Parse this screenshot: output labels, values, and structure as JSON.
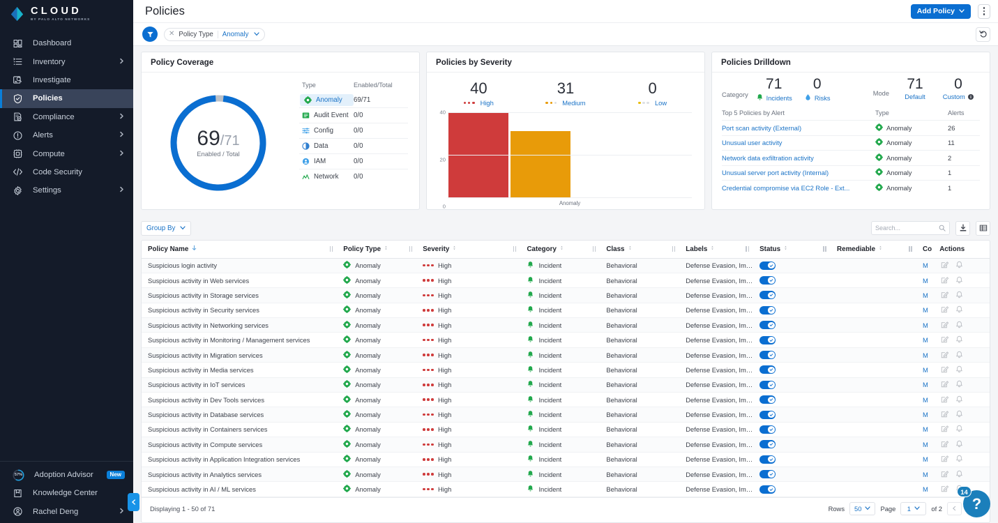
{
  "sidebar": {
    "logo": {
      "title": "CLOUD",
      "subtitle": "BY PALO ALTO NETWORKS"
    },
    "items": [
      {
        "label": "Dashboard",
        "icon": "dashboard-icon",
        "expandable": false,
        "active": false
      },
      {
        "label": "Inventory",
        "icon": "inventory-icon",
        "expandable": true,
        "active": false
      },
      {
        "label": "Investigate",
        "icon": "investigate-icon",
        "expandable": false,
        "active": false
      },
      {
        "label": "Policies",
        "icon": "shield-icon",
        "expandable": false,
        "active": true
      },
      {
        "label": "Compliance",
        "icon": "compliance-icon",
        "expandable": true,
        "active": false
      },
      {
        "label": "Alerts",
        "icon": "alert-icon",
        "expandable": true,
        "active": false
      },
      {
        "label": "Compute",
        "icon": "compute-icon",
        "expandable": true,
        "active": false
      },
      {
        "label": "Code Security",
        "icon": "code-icon",
        "expandable": false,
        "active": false
      },
      {
        "label": "Settings",
        "icon": "gear-icon",
        "expandable": true,
        "active": false
      }
    ],
    "bottom": [
      {
        "label": "Adoption Advisor",
        "icon": "progress-ring-icon",
        "progress": "57%",
        "badge": "New",
        "expandable": false
      },
      {
        "label": "Knowledge Center",
        "icon": "book-icon",
        "expandable": false
      },
      {
        "label": "Rachel Deng",
        "icon": "user-icon",
        "expandable": true
      }
    ]
  },
  "header": {
    "title": "Policies",
    "add_policy_label": "Add Policy",
    "kebab_name": "more-options"
  },
  "filter_bar": {
    "funnel_name": "filter-icon",
    "chip": {
      "key": "Policy Type",
      "value": "Anomaly"
    },
    "reset_name": "reset-filters-icon"
  },
  "policy_coverage": {
    "title": "Policy Coverage",
    "enabled": "69",
    "total": "/71",
    "center_label": "Enabled / Total",
    "columns": {
      "type": "Type",
      "enabled_total": "Enabled/Total"
    },
    "rows": [
      {
        "type": "Anomaly",
        "value": "69/71",
        "selected": true,
        "color": "#21a84c"
      },
      {
        "type": "Audit Event",
        "value": "0/0",
        "selected": false,
        "color": "#21a84c"
      },
      {
        "type": "Config",
        "value": "0/0",
        "selected": false,
        "color": "#3fa0e8"
      },
      {
        "type": "Data",
        "value": "0/0",
        "selected": false,
        "color": "#2f7fd0"
      },
      {
        "type": "IAM",
        "value": "0/0",
        "selected": false,
        "color": "#3fa0e8"
      },
      {
        "type": "Network",
        "value": "0/0",
        "selected": false,
        "color": "#21a84c"
      }
    ]
  },
  "policies_by_severity": {
    "title": "Policies by Severity",
    "stats": [
      {
        "value": "40",
        "label": "High",
        "dots": 3,
        "color": "#cf3b3b"
      },
      {
        "value": "31",
        "label": "Medium",
        "dots": 2,
        "color": "#e89b09"
      },
      {
        "value": "0",
        "label": "Low",
        "dots": 1,
        "color": "#e8bc09"
      }
    ]
  },
  "chart_data": {
    "type": "bar",
    "title": "Policies by Severity",
    "categories": [
      "Anomaly"
    ],
    "series": [
      {
        "name": "High",
        "values": [
          40
        ],
        "color": "#cf3b3b"
      },
      {
        "name": "Medium",
        "values": [
          31
        ],
        "color": "#e89b09"
      },
      {
        "name": "Low",
        "values": [
          0
        ],
        "color": "#e8bc09"
      }
    ],
    "xlabel": "",
    "ylabel": "",
    "ylim": [
      0,
      40
    ],
    "yticks": [
      "0",
      "20",
      "40"
    ],
    "grid": true,
    "legend": "top"
  },
  "policies_drilldown": {
    "title": "Policies Drilldown",
    "category_label": "Category",
    "mode_label": "Mode",
    "category_metrics": [
      {
        "value": "71",
        "label": "Incidents",
        "icon": "incident-icon"
      },
      {
        "value": "0",
        "label": "Risks",
        "icon": "risk-icon"
      }
    ],
    "mode_metrics": [
      {
        "value": "71",
        "label": "Default",
        "icon": ""
      },
      {
        "value": "0",
        "label": "Custom",
        "icon": "info-icon"
      }
    ],
    "columns": {
      "name": "Top 5 Policies by Alert",
      "type": "Type",
      "alerts": "Alerts"
    },
    "rows": [
      {
        "name": "Port scan activity (External)",
        "type": "Anomaly",
        "alerts": "26"
      },
      {
        "name": "Unusual user activity",
        "type": "Anomaly",
        "alerts": "11"
      },
      {
        "name": "Network data exfiltration activity",
        "type": "Anomaly",
        "alerts": "2"
      },
      {
        "name": "Unusual server port activity (Internal)",
        "type": "Anomaly",
        "alerts": "1"
      },
      {
        "name": "Credential compromise via EC2 Role - Ext...",
        "type": "Anomaly",
        "alerts": "1"
      }
    ]
  },
  "table_toolbar": {
    "group_by_label": "Group By",
    "search_placeholder": "Search...",
    "search_value": "",
    "download_name": "download-icon",
    "columns_name": "column-settings-icon"
  },
  "table": {
    "columns": [
      "Policy Name",
      "Policy Type",
      "Severity",
      "Category",
      "Class",
      "Labels",
      "Status",
      "Remediable",
      "Co",
      "Actions"
    ],
    "sorted_column": "Policy Name",
    "rows": [
      {
        "name": "Suspicious login activity",
        "type": "Anomaly",
        "severity": "High",
        "category": "Incident",
        "class": "Behavioral",
        "labels": "Defense Evasion, Impact",
        "status": true,
        "remediable": "",
        "compliance": "M"
      },
      {
        "name": "Suspicious activity in Web services",
        "type": "Anomaly",
        "severity": "High",
        "category": "Incident",
        "class": "Behavioral",
        "labels": "Defense Evasion, Impact",
        "status": true,
        "remediable": "",
        "compliance": "M"
      },
      {
        "name": "Suspicious activity in Storage services",
        "type": "Anomaly",
        "severity": "High",
        "category": "Incident",
        "class": "Behavioral",
        "labels": "Defense Evasion, Impact",
        "status": true,
        "remediable": "",
        "compliance": "M"
      },
      {
        "name": "Suspicious activity in Security services",
        "type": "Anomaly",
        "severity": "High",
        "category": "Incident",
        "class": "Behavioral",
        "labels": "Defense Evasion, Impact",
        "status": true,
        "remediable": "",
        "compliance": "M"
      },
      {
        "name": "Suspicious activity in Networking services",
        "type": "Anomaly",
        "severity": "High",
        "category": "Incident",
        "class": "Behavioral",
        "labels": "Defense Evasion, Impact",
        "status": true,
        "remediable": "",
        "compliance": "M"
      },
      {
        "name": "Suspicious activity in Monitoring / Management services",
        "type": "Anomaly",
        "severity": "High",
        "category": "Incident",
        "class": "Behavioral",
        "labels": "Defense Evasion, Impact",
        "status": true,
        "remediable": "",
        "compliance": "M"
      },
      {
        "name": "Suspicious activity in Migration services",
        "type": "Anomaly",
        "severity": "High",
        "category": "Incident",
        "class": "Behavioral",
        "labels": "Defense Evasion, Impact",
        "status": true,
        "remediable": "",
        "compliance": "M"
      },
      {
        "name": "Suspicious activity in Media services",
        "type": "Anomaly",
        "severity": "High",
        "category": "Incident",
        "class": "Behavioral",
        "labels": "Defense Evasion, Impact",
        "status": true,
        "remediable": "",
        "compliance": "M"
      },
      {
        "name": "Suspicious activity in IoT services",
        "type": "Anomaly",
        "severity": "High",
        "category": "Incident",
        "class": "Behavioral",
        "labels": "Defense Evasion, Impact",
        "status": true,
        "remediable": "",
        "compliance": "M"
      },
      {
        "name": "Suspicious activity in Dev Tools services",
        "type": "Anomaly",
        "severity": "High",
        "category": "Incident",
        "class": "Behavioral",
        "labels": "Defense Evasion, Impact",
        "status": true,
        "remediable": "",
        "compliance": "M"
      },
      {
        "name": "Suspicious activity in Database services",
        "type": "Anomaly",
        "severity": "High",
        "category": "Incident",
        "class": "Behavioral",
        "labels": "Defense Evasion, Impact",
        "status": true,
        "remediable": "",
        "compliance": "M"
      },
      {
        "name": "Suspicious activity in Containers services",
        "type": "Anomaly",
        "severity": "High",
        "category": "Incident",
        "class": "Behavioral",
        "labels": "Defense Evasion, Impact",
        "status": true,
        "remediable": "",
        "compliance": "M"
      },
      {
        "name": "Suspicious activity in Compute services",
        "type": "Anomaly",
        "severity": "High",
        "category": "Incident",
        "class": "Behavioral",
        "labels": "Defense Evasion, Impact",
        "status": true,
        "remediable": "",
        "compliance": "M"
      },
      {
        "name": "Suspicious activity in Application Integration services",
        "type": "Anomaly",
        "severity": "High",
        "category": "Incident",
        "class": "Behavioral",
        "labels": "Defense Evasion, Impact",
        "status": true,
        "remediable": "",
        "compliance": "M"
      },
      {
        "name": "Suspicious activity in Analytics services",
        "type": "Anomaly",
        "severity": "High",
        "category": "Incident",
        "class": "Behavioral",
        "labels": "Defense Evasion, Impact",
        "status": true,
        "remediable": "",
        "compliance": "M"
      },
      {
        "name": "Suspicious activity in AI / ML services",
        "type": "Anomaly",
        "severity": "High",
        "category": "Incident",
        "class": "Behavioral",
        "labels": "Defense Evasion, Impact",
        "status": true,
        "remediable": "",
        "compliance": "M"
      }
    ]
  },
  "footer": {
    "displaying": "Displaying 1 - 50 of 71",
    "rows_label": "Rows",
    "rows_value": "50",
    "page_label": "Page",
    "page_value": "1",
    "of_label": "of 2"
  },
  "help": {
    "badge": "14",
    "glyph": "?"
  },
  "colors": {
    "accent": "#0a6ed1",
    "link": "#1a73c7",
    "high": "#cf3b3b",
    "medium": "#e89b09",
    "low": "#e8bc09",
    "green": "#21a84c",
    "sidebar_bg": "#141b29"
  }
}
